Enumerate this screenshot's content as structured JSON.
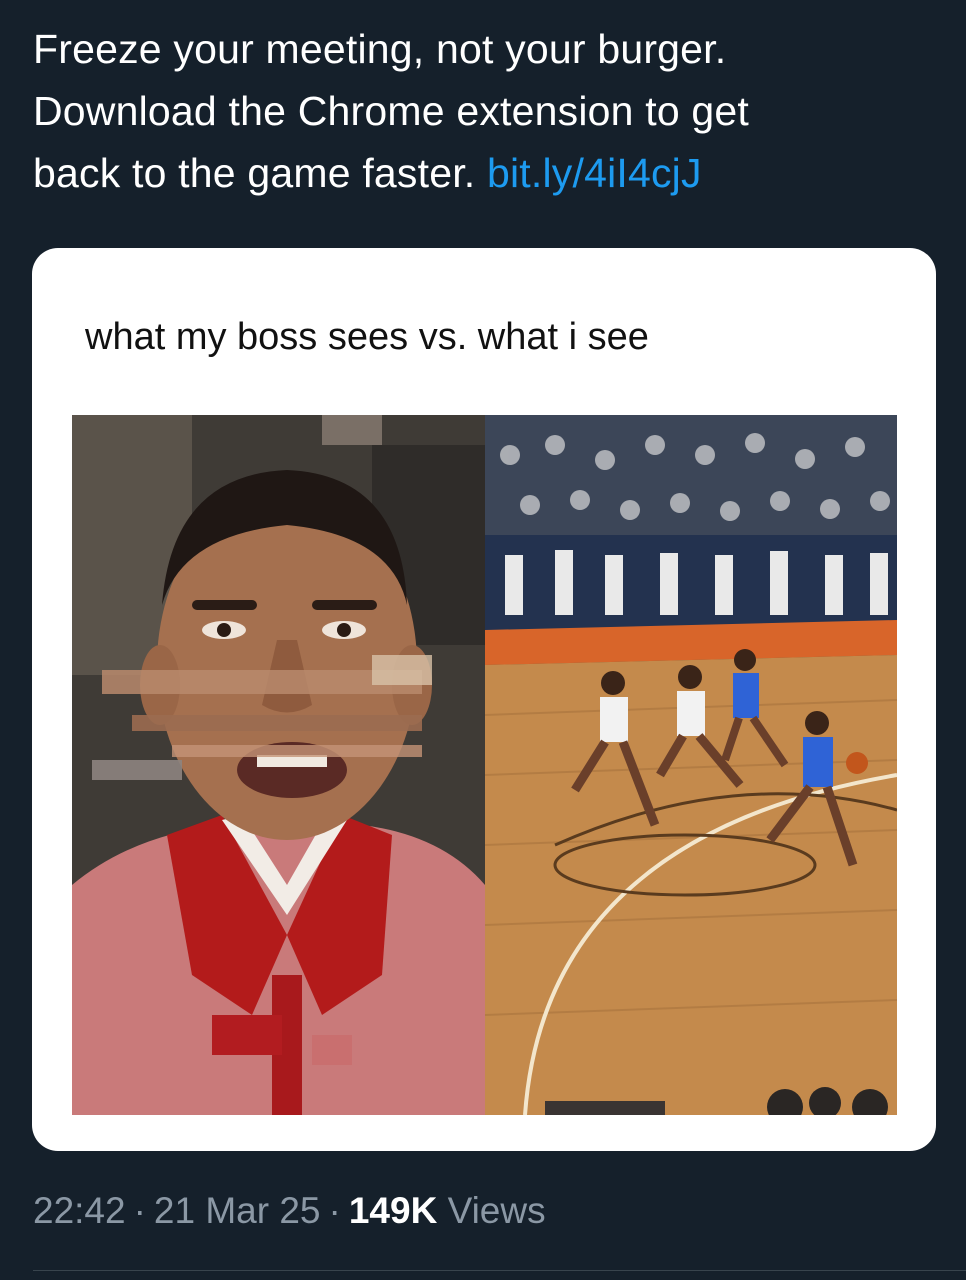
{
  "tweet": {
    "text_line1": "Freeze your meeting, not your burger.",
    "text_line2": "Download the Chrome extension to get",
    "text_line3": "back to the game faster.",
    "link": "bit.ly/4iI4cjJ"
  },
  "media": {
    "caption": "what my boss sees vs. what i see",
    "left_panel": "glitched frozen video call face",
    "right_panel": "basketball game fast break"
  },
  "meta": {
    "time": "22:42",
    "date": "21 Mar 25",
    "views_count": "149K",
    "views_label": "Views",
    "separator": "·"
  },
  "colors": {
    "background": "#15202b",
    "link": "#1d9bf0",
    "meta_text": "#8b98a5"
  }
}
